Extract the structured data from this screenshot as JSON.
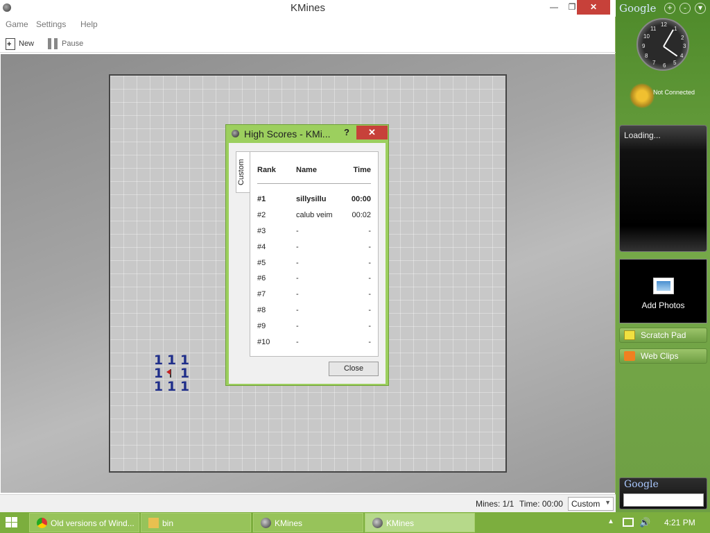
{
  "window": {
    "title": "KMines",
    "minimize": "—",
    "maximize": "❐",
    "close": "✕"
  },
  "menu": {
    "game": "Game",
    "settings": "Settings",
    "help": "Help"
  },
  "toolbar": {
    "new_label": "New",
    "pause_label": "Pause"
  },
  "board": {
    "numbers": [
      "1",
      "1",
      "1",
      "1",
      "1",
      "1",
      "1",
      "1"
    ]
  },
  "status": {
    "mines": "Mines: 1/1",
    "time": "Time: 00:00",
    "difficulty": "Custom"
  },
  "high_scores": {
    "title": "High Scores - KMi...",
    "help": "?",
    "close_x": "✕",
    "tab": "Custom",
    "headers": {
      "rank": "Rank",
      "name": "Name",
      "time": "Time"
    },
    "rows": [
      {
        "rank": "#1",
        "name": "sillysillu",
        "time": "00:00"
      },
      {
        "rank": "#2",
        "name": "calub veim",
        "time": "00:02"
      },
      {
        "rank": "#3",
        "name": "-",
        "time": "-"
      },
      {
        "rank": "#4",
        "name": "-",
        "time": "-"
      },
      {
        "rank": "#5",
        "name": "-",
        "time": "-"
      },
      {
        "rank": "#6",
        "name": "-",
        "time": "-"
      },
      {
        "rank": "#7",
        "name": "-",
        "time": "-"
      },
      {
        "rank": "#8",
        "name": "-",
        "time": "-"
      },
      {
        "rank": "#9",
        "name": "-",
        "time": "-"
      },
      {
        "rank": "#10",
        "name": "-",
        "time": "-"
      }
    ],
    "close_button": "Close"
  },
  "sidebar": {
    "logo": "Google",
    "add": "+",
    "menu": "-",
    "down": "▾",
    "clock_numbers": [
      "12",
      "1",
      "2",
      "3",
      "4",
      "5",
      "6",
      "7",
      "8",
      "9",
      "10",
      "11"
    ],
    "connection_status": "Not Connected",
    "loading": "Loading...",
    "add_photos": "Add Photos",
    "scratch_pad": "Scratch Pad",
    "web_clips": "Web Clips",
    "search_logo": "Google"
  },
  "taskbar": {
    "tasks": [
      {
        "label": "Old versions of Wind...",
        "icon": "chrome-icon"
      },
      {
        "label": "bin",
        "icon": "folder-icon"
      },
      {
        "label": "KMines",
        "icon": "kmines-icon"
      },
      {
        "label": "KMines",
        "icon": "kmines-icon"
      }
    ],
    "tray_arrow": "▲",
    "volume": "🔊",
    "clock": "4:21 PM"
  },
  "colors": {
    "accent_green": "#7cae3e",
    "close_red": "#c7413a",
    "mine_number_blue": "#1f2e8a",
    "flag_red": "#c02020"
  }
}
